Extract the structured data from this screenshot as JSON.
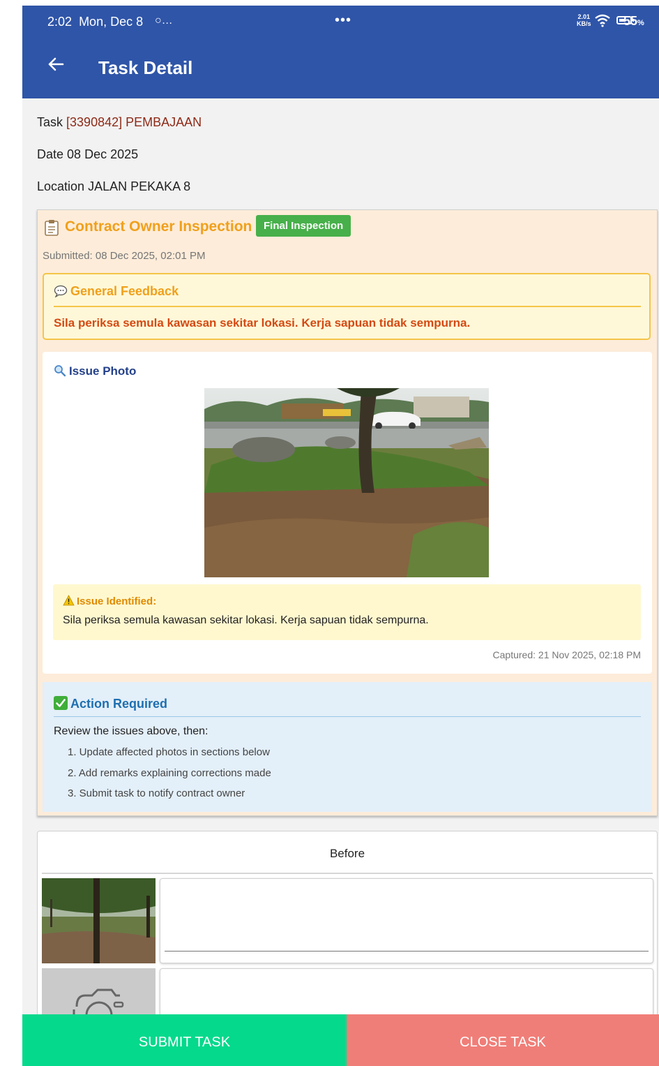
{
  "status_bar": {
    "time": "2:02",
    "date": "Mon, Dec 8",
    "whatsapp": "…",
    "center_dots": "•••",
    "net_speed": "2.01",
    "net_unit": "KB/s",
    "battery_pct": "55",
    "battery_unit": "%"
  },
  "app_bar": {
    "title": "Task Detail"
  },
  "task": {
    "task_label": "Task",
    "task_value": "[3390842] PEMBAJAAN",
    "date_label": "Date",
    "date_value": "08 Dec 2025",
    "location_label": "Location",
    "location_value": "JALAN PEKAKA 8"
  },
  "inspection": {
    "title": "Contract Owner Inspection",
    "badge": "Final Inspection",
    "submitted": "Submitted: 08 Dec 2025, 02:01 PM",
    "feedback_heading": "General Feedback",
    "feedback_text": "Sila periksa semula kawasan sekitar lokasi. Kerja sapuan tidak sempurna.",
    "photo_heading": "Issue Photo",
    "issue_heading": "Issue Identified:",
    "issue_text": "Sila periksa semula kawasan sekitar lokasi. Kerja sapuan tidak sempurna.",
    "captured": "Captured: 21 Nov 2025, 02:18 PM",
    "action_heading": "Action Required",
    "action_intro": "Review the issues above, then:",
    "action_steps": [
      "1. Update affected photos in sections below",
      "2. Add remarks explaining corrections made",
      "3. Submit task to notify contract owner"
    ]
  },
  "before_section": {
    "heading": "Before"
  },
  "buttons": {
    "submit": "SUBMIT TASK",
    "close": "CLOSE TASK"
  },
  "colors": {
    "primary": "#2f55a8",
    "submit": "#05d98c",
    "close": "#f07e78",
    "warning": "#f0a01c",
    "badge": "#47b04a"
  }
}
